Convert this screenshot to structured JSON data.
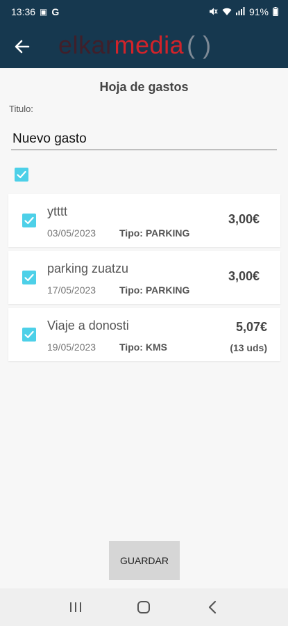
{
  "status_bar": {
    "time": "13:36",
    "g_label": "G",
    "battery": "91%"
  },
  "app": {
    "logo_part1": "elkar",
    "logo_part2": "media",
    "logo_part3": "( )"
  },
  "page": {
    "title": "Hoja de gastos",
    "field_label": "Titulo:",
    "title_value": "Nuevo gasto"
  },
  "expenses": [
    {
      "name": "ytttt",
      "date": "03/05/2023",
      "type": "Tipo: PARKING",
      "amount": "3,00€",
      "units": ""
    },
    {
      "name": "parking zuatzu",
      "date": "17/05/2023",
      "type": "Tipo: PARKING",
      "amount": "3,00€",
      "units": ""
    },
    {
      "name": "Viaje a donosti",
      "date": "19/05/2023",
      "type": "Tipo: KMS",
      "amount": "5,07€",
      "units": "(13 uds)"
    }
  ],
  "buttons": {
    "save": "GUARDAR"
  },
  "colors": {
    "app_bar": "#16384f",
    "checkbox": "#4dd0e8",
    "logo_red": "#d2232a"
  },
  "icons": [
    "back-arrow-icon",
    "recent-apps-icon",
    "home-icon",
    "nav-back-icon",
    "check-icon"
  ]
}
